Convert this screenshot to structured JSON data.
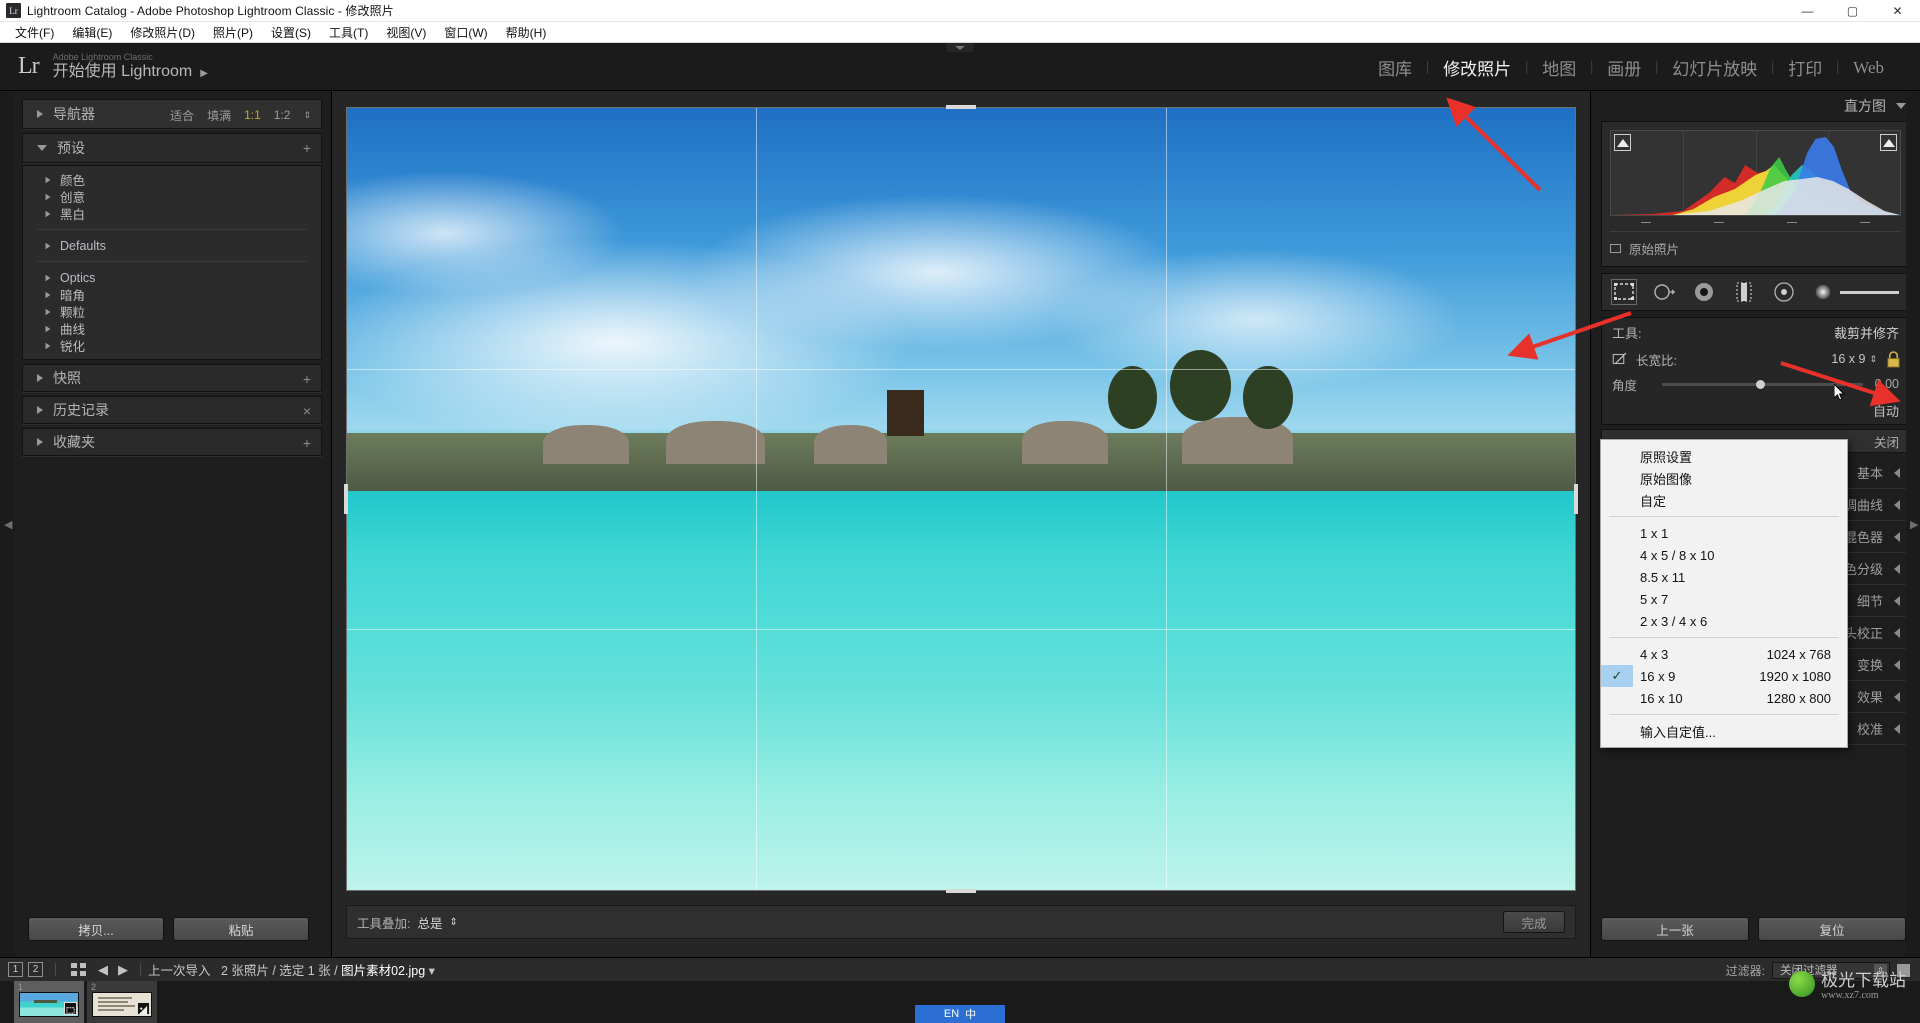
{
  "window": {
    "title": "Lightroom Catalog - Adobe Photoshop Lightroom Classic - 修改照片",
    "app_icon": "Lr",
    "minimize": "—",
    "maximize": "▢",
    "close": "✕"
  },
  "menubar": [
    {
      "label": "文件(F)"
    },
    {
      "label": "编辑(E)"
    },
    {
      "label": "修改照片(D)"
    },
    {
      "label": "照片(P)"
    },
    {
      "label": "设置(S)"
    },
    {
      "label": "工具(T)"
    },
    {
      "label": "视图(V)"
    },
    {
      "label": "窗口(W)"
    },
    {
      "label": "帮助(H)"
    }
  ],
  "identity": {
    "logo": "Lr",
    "small_line": "Adobe Lightroom Classic",
    "big_line": "开始使用 Lightroom",
    "disclosure": "▶"
  },
  "modules": [
    {
      "label": "图库",
      "active": false
    },
    {
      "label": "修改照片",
      "active": true
    },
    {
      "label": "地图",
      "active": false
    },
    {
      "label": "画册",
      "active": false
    },
    {
      "label": "幻灯片放映",
      "active": false
    },
    {
      "label": "打印",
      "active": false
    },
    {
      "label": "Web",
      "active": false
    }
  ],
  "left_panel": {
    "navigator": {
      "title": "导航器",
      "fit": "适合",
      "fill": "填满",
      "zoom_1_1": "1:1",
      "zoom_1_2": "1:2"
    },
    "presets": {
      "title": "预设",
      "add": "+",
      "groups_cn": [
        {
          "label": "颜色"
        },
        {
          "label": "创意"
        },
        {
          "label": "黑白"
        }
      ],
      "groups_default": [
        {
          "label": "Defaults"
        }
      ],
      "groups_en": [
        {
          "label": "Optics"
        },
        {
          "label": "暗角"
        },
        {
          "label": "颗粒"
        },
        {
          "label": "曲线"
        },
        {
          "label": "锐化"
        }
      ]
    },
    "sections": [
      {
        "label": "快照",
        "action": "+"
      },
      {
        "label": "历史记录",
        "action": "×"
      },
      {
        "label": "收藏夹",
        "action": "+"
      }
    ],
    "buttons": {
      "copy": "拷贝...",
      "paste": "粘贴"
    }
  },
  "center": {
    "toolbar": {
      "overlay_label": "工具叠加:",
      "overlay_value": "总是",
      "stepper": "⇕",
      "done": "完成"
    }
  },
  "right_panel": {
    "histogram_title": "直方图",
    "original_photo": "原始照片",
    "tools": [
      {
        "name": "crop-tool",
        "selected": true
      },
      {
        "name": "spot-removal-tool",
        "selected": false
      },
      {
        "name": "red-eye-tool",
        "selected": false
      },
      {
        "name": "masking-tool",
        "selected": false
      },
      {
        "name": "radial-filter-tool",
        "selected": false
      },
      {
        "name": "amount-slider",
        "selected": false
      }
    ],
    "tool_label": "工具:",
    "tool_value": "裁剪并修齐",
    "aspect_label": "长宽比:",
    "aspect_value": "16 x 9",
    "aspect_stepper": "⇕",
    "angle_label": "角度",
    "angle_value": "0.00",
    "auto_label": "自动",
    "close_label": "关闭",
    "sections": [
      {
        "label": "基本"
      },
      {
        "label": "色调曲线"
      },
      {
        "label": "混色器"
      },
      {
        "label": "颜色分级"
      },
      {
        "label": "细节"
      },
      {
        "label": "镜头校正"
      },
      {
        "label": "变换"
      },
      {
        "label": "效果"
      },
      {
        "label": "校准"
      }
    ],
    "buttons": {
      "previous": "上一张",
      "reset": "复位"
    }
  },
  "aspect_menu": {
    "top_items": [
      {
        "label": "原照设置",
        "dim": "",
        "checked": false
      },
      {
        "label": "原始图像",
        "dim": "",
        "checked": false
      },
      {
        "label": "自定",
        "dim": "",
        "checked": false
      }
    ],
    "ratio_items": [
      {
        "label": "1 x 1",
        "dim": "",
        "checked": false
      },
      {
        "label": "4 x 5  /  8 x 10",
        "dim": "",
        "checked": false
      },
      {
        "label": "8.5 x 11",
        "dim": "",
        "checked": false
      },
      {
        "label": "5 x 7",
        "dim": "",
        "checked": false
      },
      {
        "label": "2 x 3  /  4 x 6",
        "dim": "",
        "checked": false
      }
    ],
    "pixel_items": [
      {
        "label": "4 x 3",
        "dim": "1024 x 768",
        "checked": false
      },
      {
        "label": "16 x 9",
        "dim": "1920 x 1080",
        "checked": true
      },
      {
        "label": "16 x 10",
        "dim": "1280 x 800",
        "checked": false
      }
    ],
    "footer_items": [
      {
        "label": "输入自定值...",
        "dim": "",
        "checked": false
      }
    ],
    "checkmark": "✓"
  },
  "filmstrip_bar": {
    "page_1": "1",
    "page_2": "2",
    "back": "◀",
    "forward": "▶",
    "breadcrumb_source": "上一次导入",
    "breadcrumb_count": "2 张照片 / 选定 1 张 /",
    "breadcrumb_file": "图片素材02.jpg",
    "breadcrumb_caret": "▾",
    "filter_label": "过滤器:",
    "filter_value": "关闭过滤器"
  },
  "filmstrip": {
    "thumbs": [
      {
        "index": "1",
        "selected": true,
        "badge": "crop-badge"
      },
      {
        "index": "2",
        "selected": false,
        "badge": "develop-badge"
      }
    ]
  },
  "watermark": {
    "title": "极光下载站",
    "sub": "www.xz7.com"
  },
  "ime": {
    "lang": "EN",
    "mode": "中"
  },
  "colors": {
    "accent_gold": "#c9a23c",
    "menu_highlight": "#a8d0f0",
    "arrow_red": "#e8312a",
    "panel_bg": "#1e1e1e"
  }
}
